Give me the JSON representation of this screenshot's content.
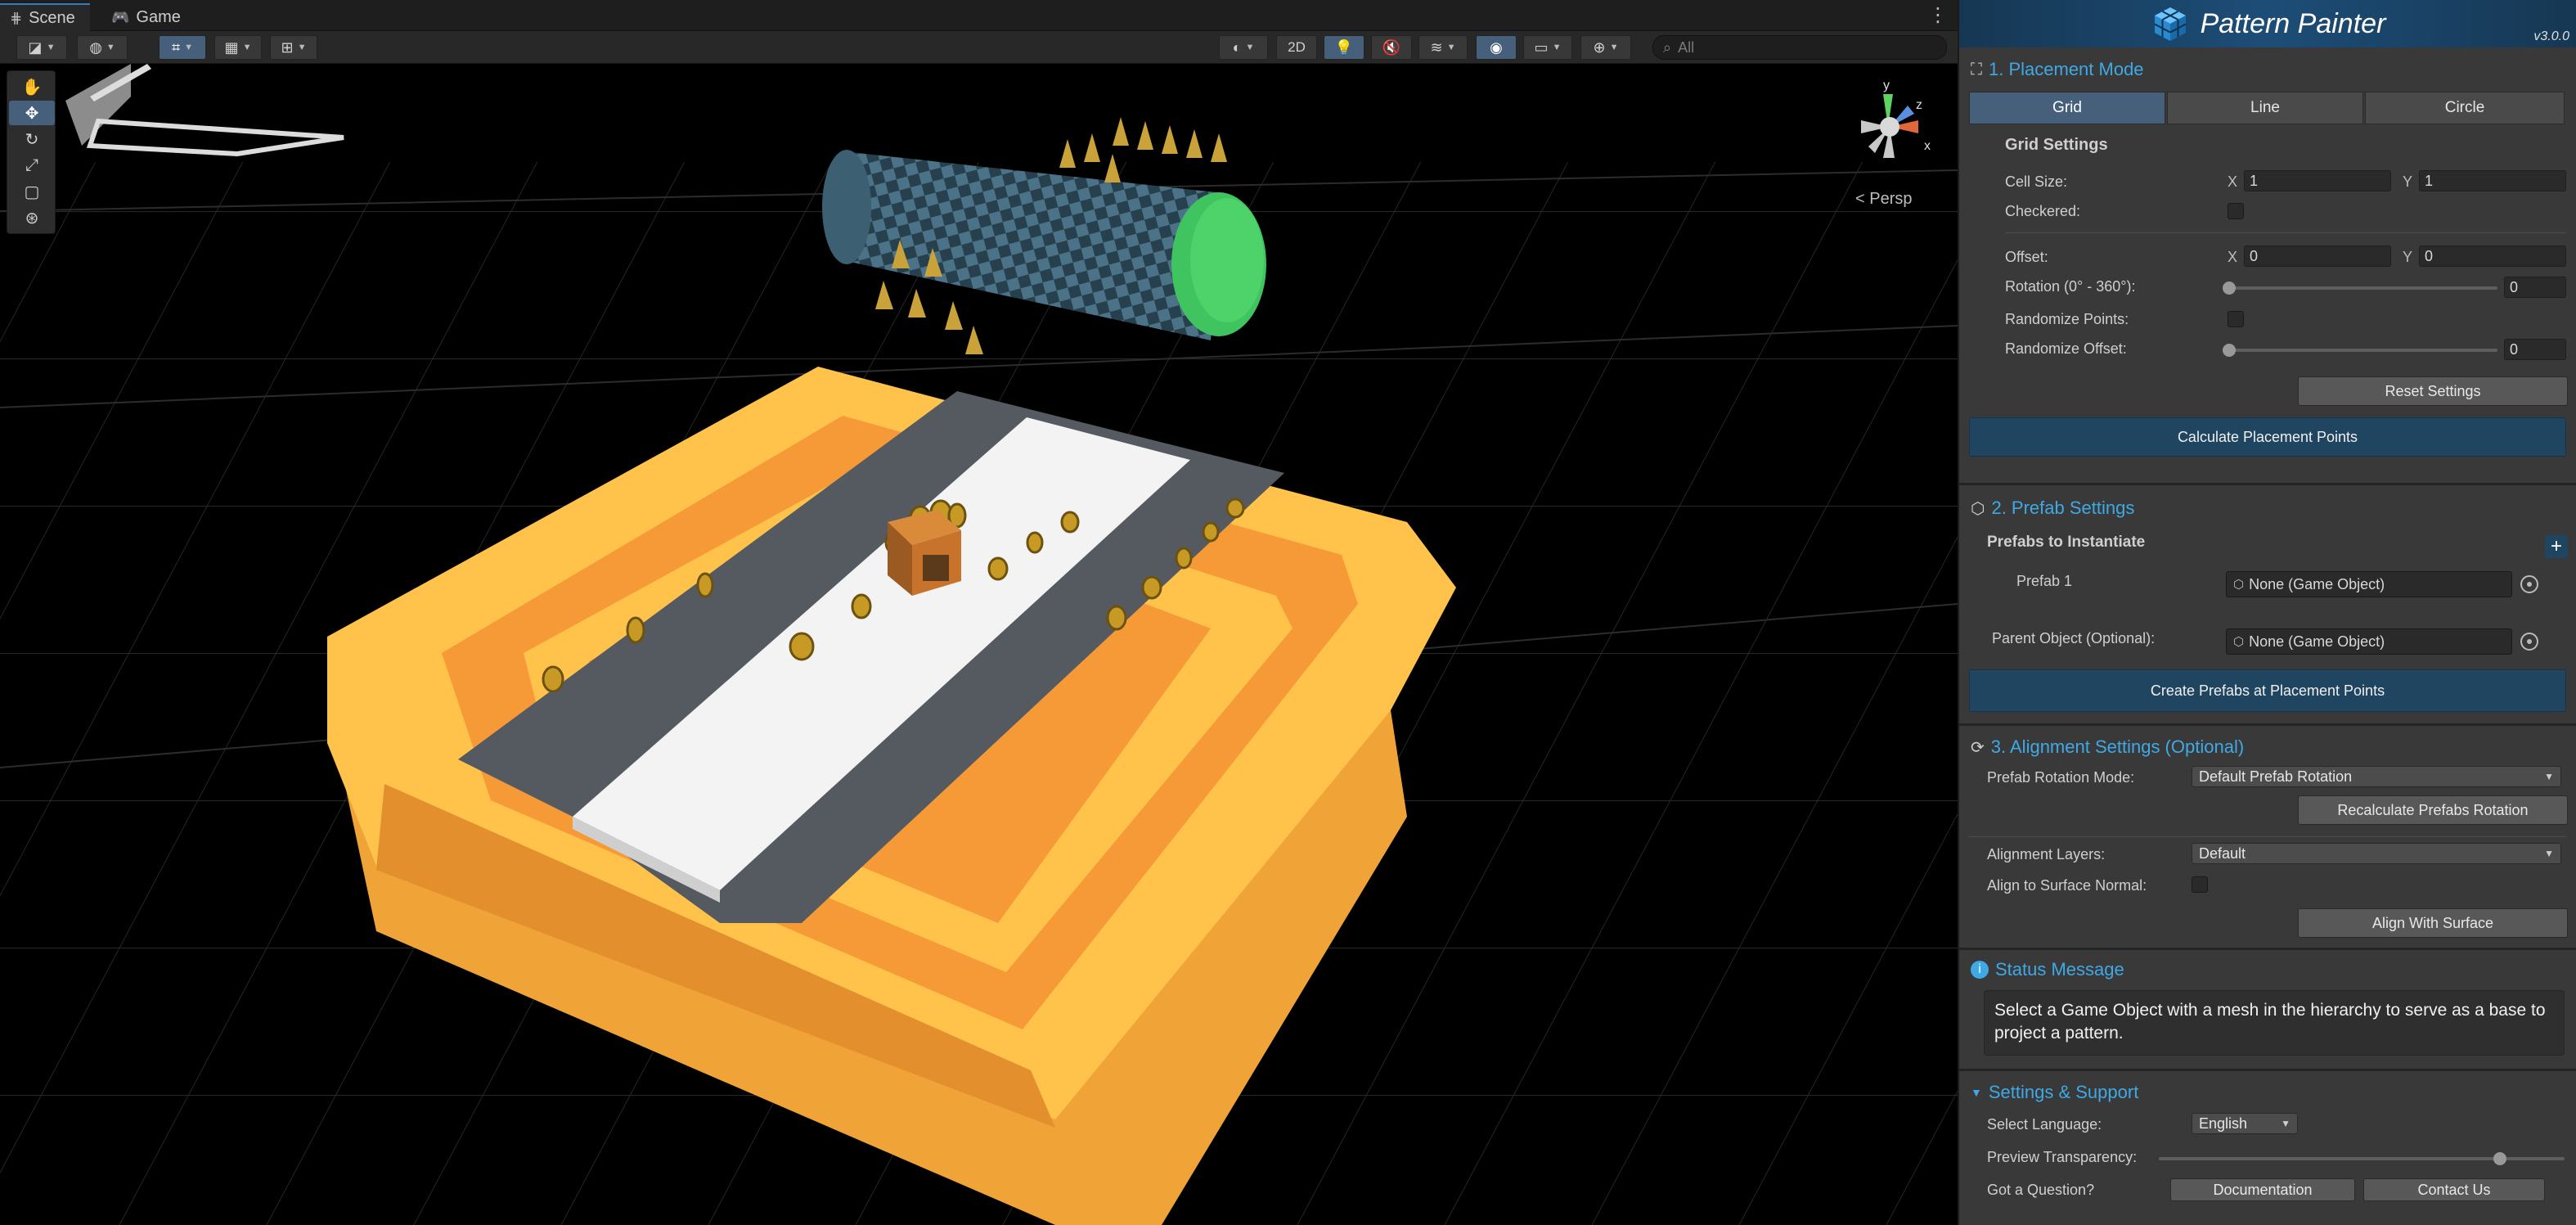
{
  "tabs": [
    {
      "label": "Scene",
      "icon": "grid-icon"
    },
    {
      "label": "Game",
      "icon": "gamepad-icon"
    }
  ],
  "toolbar": {
    "mode_2d": "2D",
    "search_placeholder": "All"
  },
  "scene": {
    "projection_label": "< Persp",
    "axis_x": "x",
    "axis_y": "y",
    "axis_z": "z"
  },
  "panel": {
    "title": "Pattern Painter",
    "version": "v3.0.0",
    "placement": {
      "title": "1. Placement Mode",
      "modes": [
        "Grid",
        "Line",
        "Circle"
      ],
      "active_mode": "Grid",
      "grid_settings_title": "Grid Settings",
      "cell_size_label": "Cell Size:",
      "cell_size_x": "1",
      "cell_size_y": "1",
      "checkered_label": "Checkered:",
      "offset_label": "Offset:",
      "offset_x": "0",
      "offset_y": "0",
      "rotation_label": "Rotation (0° - 360°):",
      "rotation_value": "0",
      "randomize_points_label": "Randomize Points:",
      "randomize_offset_label": "Randomize Offset:",
      "randomize_offset_value": "0",
      "x_label": "X",
      "y_label": "Y",
      "reset_button": "Reset Settings",
      "calculate_button": "Calculate Placement Points"
    },
    "prefab": {
      "title": "2. Prefab Settings",
      "prefabs_label": "Prefabs to Instantiate",
      "add_label": "+",
      "prefab1_label": "Prefab 1",
      "prefab1_value": "None (Game Object)",
      "parent_label": "Parent Object (Optional):",
      "parent_value": "None (Game Object)",
      "create_button": "Create Prefabs at Placement Points"
    },
    "alignment": {
      "title": "3. Alignment Settings (Optional)",
      "rotation_mode_label": "Prefab Rotation Mode:",
      "rotation_mode_value": "Default Prefab Rotation",
      "recalc_button": "Recalculate Prefabs Rotation",
      "layers_label": "Alignment Layers:",
      "layers_value": "Default",
      "surface_normal_label": "Align to Surface Normal:",
      "align_button": "Align With Surface"
    },
    "status": {
      "title": "Status Message",
      "message": "Select a Game Object with a mesh in the hierarchy to serve as a base to project a pattern."
    },
    "support": {
      "title": "Settings & Support",
      "language_label": "Select Language:",
      "language_value": "English",
      "transparency_label": "Preview Transparency:",
      "transparency": 0.84,
      "question_label": "Got a Question?",
      "docs_button": "Documentation",
      "contact_button": "Contact Us"
    }
  },
  "colors": {
    "accent": "#3fa9e6",
    "primary_button": "#1f4560",
    "active_segment": "#46607c",
    "platform_yellow": "#ffc24a",
    "platform_orange": "#f59a36",
    "cylinder_end": "#4ed36b"
  }
}
